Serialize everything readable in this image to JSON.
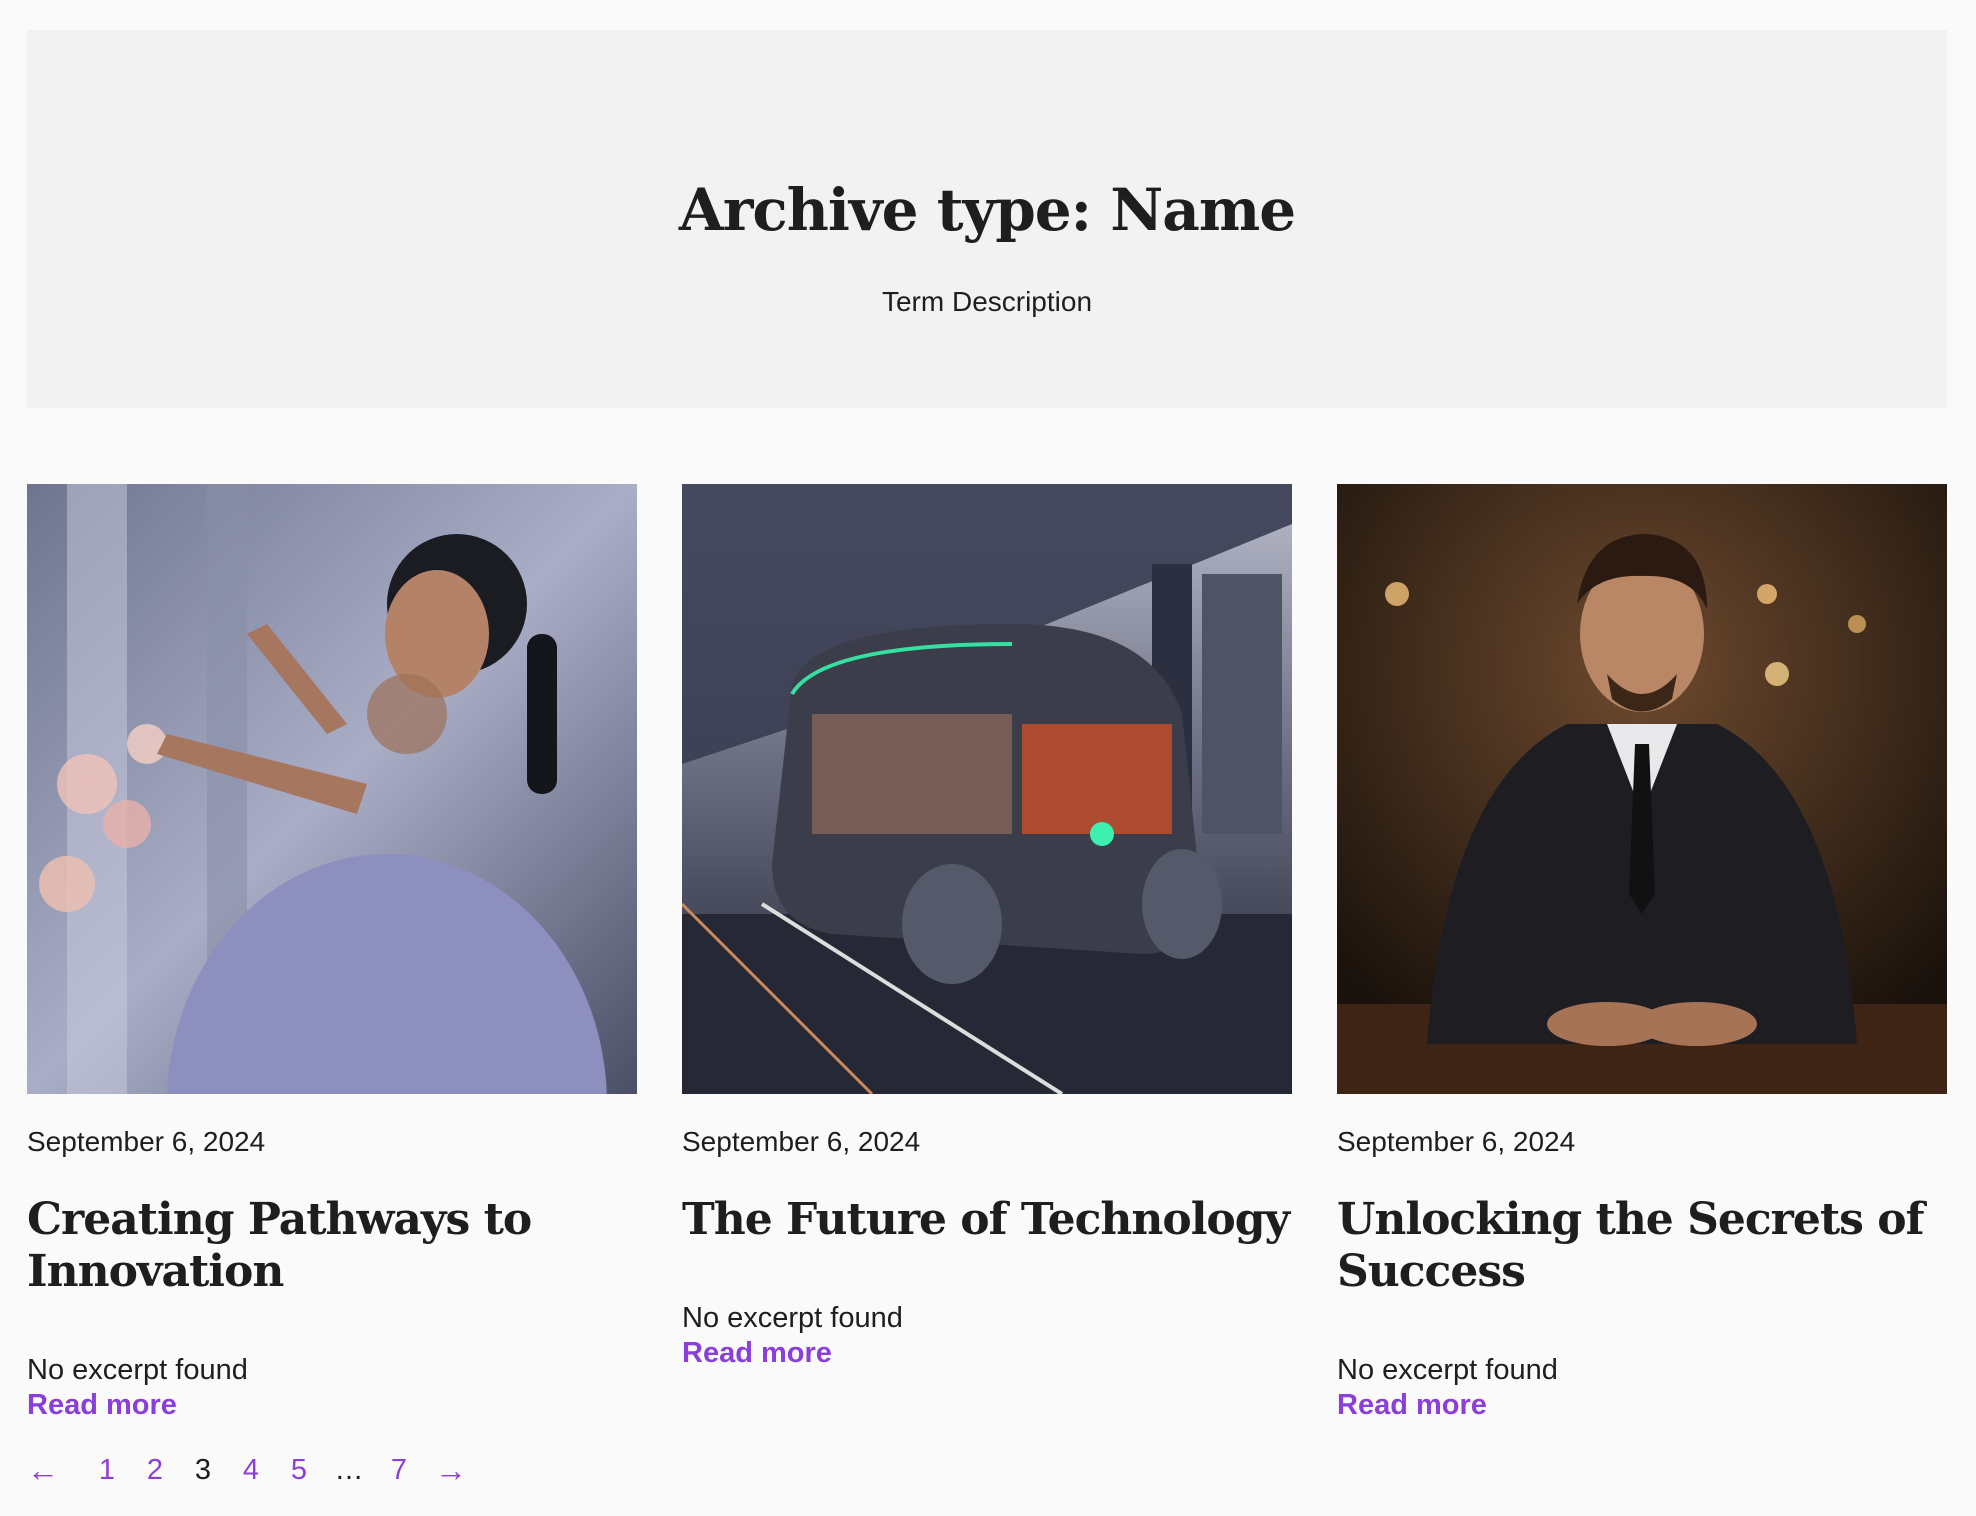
{
  "archive": {
    "title": "Archive type: Name",
    "description": "Term Description"
  },
  "posts": [
    {
      "date": "September 6, 2024",
      "title": "Creating Pathways to Innovation",
      "excerpt": "No excerpt found",
      "read_more": "Read more"
    },
    {
      "date": "September 6, 2024",
      "title": "The Future of Technology",
      "excerpt": "No excerpt found",
      "read_more": "Read more"
    },
    {
      "date": "September 6, 2024",
      "title": "Unlocking the Secrets of Success",
      "excerpt": "No excerpt found",
      "read_more": "Read more"
    }
  ],
  "pagination": {
    "prev": "←",
    "pages": [
      "1",
      "2",
      "3",
      "4",
      "5"
    ],
    "current": "3",
    "ellipsis": "…",
    "last": "7",
    "next": "→"
  },
  "colors": {
    "link": "#8b3fd9",
    "text": "#1e1e1e",
    "header_bg": "#f2f2f2",
    "page_bg": "#fafafa"
  }
}
